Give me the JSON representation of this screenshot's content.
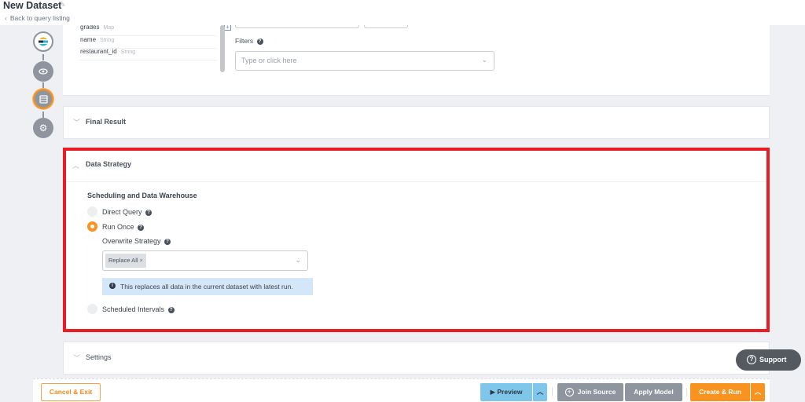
{
  "header": {
    "title": "New Dataset",
    "edit_icon": "pencil-icon",
    "back_link": "Back to query listing"
  },
  "stepper": {
    "steps": [
      {
        "icon": "elasticsearch-source-icon",
        "state": "done"
      },
      {
        "icon": "eye-icon",
        "state": "done"
      },
      {
        "icon": "dataset-icon",
        "state": "active"
      },
      {
        "icon": "gear-icon",
        "state": "pending"
      }
    ]
  },
  "fields": [
    {
      "name": "grades",
      "type": "Map"
    },
    {
      "name": "name",
      "type": "String"
    },
    {
      "name": "restaurant_id",
      "type": "String"
    }
  ],
  "filters": {
    "label": "Filters",
    "placeholder": "Type or click here"
  },
  "sections": {
    "final_result": "Final Result",
    "data_strategy": "Data Strategy",
    "settings": "Settings"
  },
  "data_strategy": {
    "heading": "Scheduling and Data Warehouse",
    "options": [
      {
        "label": "Direct Query",
        "selected": false
      },
      {
        "label": "Run Once",
        "selected": true
      },
      {
        "label": "Scheduled Intervals",
        "selected": false
      }
    ],
    "overwrite_label": "Overwrite Strategy",
    "overwrite_value": "Replace All",
    "info": "This replaces all data in the current dataset with latest run."
  },
  "footer": {
    "cancel": "Cancel & Exit",
    "preview": "Preview",
    "join_source": "Join Source",
    "apply_model": "Apply Model",
    "create_run": "Create & Run"
  },
  "support": "Support",
  "colors": {
    "accent": "#f7931e",
    "highlight": "#ea1c24",
    "preview": "#7ec6ea",
    "neutral_button": "#8e959f",
    "info_bg": "#d3e7f8"
  }
}
